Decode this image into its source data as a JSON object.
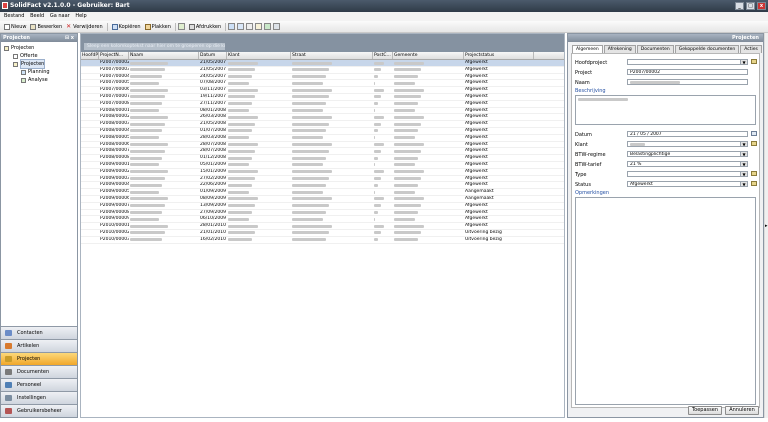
{
  "window": {
    "title": "SolidFact v2.1.0.0 - Gebruiker: Bart",
    "minimize": "_",
    "maximize": "□",
    "close": "x"
  },
  "menu": [
    "Bestand",
    "Beeld",
    "Ga naar",
    "Help"
  ],
  "toolbar": {
    "new": "Nieuw",
    "edit": "Bewerken",
    "delete": "Verwijderen",
    "copy": "Kopiëren",
    "paste": "Plakken",
    "print": "Afdrukken"
  },
  "left": {
    "title": "Projecten",
    "pin": "⊟ x",
    "tree": [
      {
        "label": "Projecten",
        "level": 0
      },
      {
        "label": "Offerte",
        "level": 1
      },
      {
        "label": "Projecten",
        "level": 1,
        "selected": true
      },
      {
        "label": "Planning",
        "level": 2
      },
      {
        "label": "Analyse",
        "level": 2
      }
    ],
    "nav": [
      {
        "label": "Contacten",
        "color": "#6b8cc7"
      },
      {
        "label": "Artikelen",
        "color": "#d87a2e"
      },
      {
        "label": "Projecten",
        "color": "#c99c2a",
        "active": true
      },
      {
        "label": "Documenten",
        "color": "#7a7a7a"
      },
      {
        "label": "Personeel",
        "color": "#4f7fb5"
      },
      {
        "label": "Instellingen",
        "color": "#7b8da0"
      },
      {
        "label": "Gebruikersbeheer",
        "color": "#b45555"
      }
    ]
  },
  "grid": {
    "group_hint": "Sleep een kolomkoptekst naar hier om te groeperen op die kolom",
    "columns": [
      "HoofdProje...",
      "ProjectN...",
      "Naam",
      "Datum",
      "Klant",
      "Straat",
      "PostC...",
      "Gemeente",
      "Projectstatus"
    ],
    "rows": [
      {
        "nr": "P2007/00002",
        "date": "21/05/2007",
        "status": "Afgewerkt",
        "selected": true
      },
      {
        "nr": "P2007/00003",
        "date": "21/05/2007",
        "status": "Afgewerkt"
      },
      {
        "nr": "P2007/00004",
        "date": "24/05/2007",
        "status": "Afgewerkt"
      },
      {
        "nr": "P2007/00005",
        "date": "07/08/2007",
        "status": "Afgewerkt"
      },
      {
        "nr": "P2007/00006",
        "date": "03/11/2007",
        "status": "Afgewerkt"
      },
      {
        "nr": "P2007/00007",
        "date": "19/11/2007",
        "status": "Afgewerkt"
      },
      {
        "nr": "P2007/00008",
        "date": "27/11/2007",
        "status": "Afgewerkt"
      },
      {
        "nr": "P2008/00001",
        "date": "08/01/2008",
        "status": "Afgewerkt"
      },
      {
        "nr": "P2008/00002",
        "date": "26/03/2008",
        "status": "Afgewerkt"
      },
      {
        "nr": "P2008/00003",
        "date": "21/05/2008",
        "status": "Afgewerkt"
      },
      {
        "nr": "P2008/00004",
        "date": "01/07/2008",
        "status": "Afgewerkt"
      },
      {
        "nr": "P2008/00005",
        "date": "28/03/2008",
        "status": "Afgewerkt"
      },
      {
        "nr": "P2008/00006",
        "date": "28/07/2008",
        "status": "Afgewerkt"
      },
      {
        "nr": "P2008/00007",
        "date": "28/07/2008",
        "status": "Afgewerkt"
      },
      {
        "nr": "P2008/00008",
        "date": "01/12/2008",
        "status": "Afgewerkt"
      },
      {
        "nr": "P2009/00001",
        "date": "05/01/2009",
        "status": "Afgewerkt"
      },
      {
        "nr": "P2009/00002",
        "date": "15/01/2009",
        "status": "Afgewerkt"
      },
      {
        "nr": "P2009/00003",
        "date": "27/02/2009",
        "status": "Afgewerkt"
      },
      {
        "nr": "P2009/00004",
        "date": "22/06/2009",
        "status": "Afgewerkt"
      },
      {
        "nr": "P2009/00005",
        "date": "01/09/2009",
        "status": "Aangemaakt"
      },
      {
        "nr": "P2009/00006",
        "date": "08/09/2009",
        "status": "Aangemaakt"
      },
      {
        "nr": "P2009/00007",
        "date": "13/09/2009",
        "status": "Afgewerkt"
      },
      {
        "nr": "P2009/00008",
        "date": "27/09/2009",
        "status": "Afgewerkt"
      },
      {
        "nr": "P2009/00009",
        "date": "06/10/2009",
        "status": "Afgewerkt"
      },
      {
        "nr": "P2010/00001",
        "date": "28/01/2010",
        "status": "Afgewerkt"
      },
      {
        "nr": "P2010/00002",
        "date": "21/01/2010",
        "status": "Uitvoering bezig"
      },
      {
        "nr": "P2010/00003",
        "date": "16/02/2010",
        "status": "Uitvoering bezig"
      }
    ]
  },
  "right": {
    "title": "Projecten",
    "tabs": [
      "Algemeen",
      "Afrekening",
      "Documenten",
      "Gekoppelde documenten",
      "Acties"
    ],
    "fields": {
      "hoofdproject_label": "Hoofdproject",
      "project_label": "Project",
      "project_value": "P2007/00002",
      "naam_label": "Naam",
      "beschrijving_label": "Beschrijving",
      "datum_label": "Datum",
      "datum_value": "21 / 05 / 2007",
      "klant_label": "Klant",
      "btwregime_label": "BTW-regime",
      "btwregime_value": "Belastingplichtige",
      "btwtarief_label": "BTW-tarief",
      "btwtarief_value": "21 %",
      "type_label": "Type",
      "status_label": "Status",
      "status_value": "Afgewerkt",
      "opmerkingen_label": "Opmerkingen"
    },
    "buttons": {
      "apply": "Toepassen",
      "cancel": "Annuleren"
    }
  }
}
